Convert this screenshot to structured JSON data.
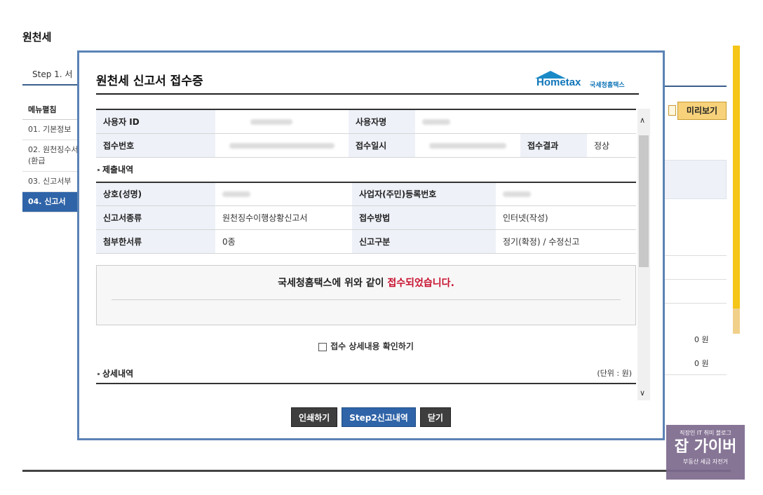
{
  "background": {
    "page_title": "원천세",
    "step_label": "Step 1. 서",
    "menu_head": "메뉴펼침",
    "menu_items": [
      {
        "label": "01. 기본정보"
      },
      {
        "label": "02. 원천징수서(환급"
      },
      {
        "label": "03. 신고서부"
      },
      {
        "label": "04. 신고서"
      }
    ],
    "preview_label": "미리보기",
    "won_values": [
      "0 원",
      "0 원"
    ],
    "accent_color": "#2f64a8",
    "stripe_color": "#f5c518"
  },
  "modal": {
    "title": "원천세 신고서 접수증",
    "logo_text": "Hometax",
    "logo_kr": "국세청홈택스",
    "receipt_table": {
      "row1": {
        "user_id_label": "사용자 ID",
        "user_name_label": "사용자명"
      },
      "row2": {
        "receipt_no_label": "접수번호",
        "receipt_date_label": "접수일시",
        "result_label": "접수결과",
        "result_value": "정상"
      }
    },
    "submission_section": "제출내역",
    "submission_table": {
      "row1": {
        "company_label": "상호(성명)",
        "biz_no_label": "사업자(주민)등록번호"
      },
      "row2": {
        "report_type_label": "신고서종류",
        "report_type_value": "원천징수이행상황신고서",
        "method_label": "접수방법",
        "method_value": "인터넷(작성)"
      },
      "row3": {
        "attach_label": "첨부한서류",
        "attach_value": "0종",
        "category_label": "신고구분",
        "category_value": "정기(확정) / 수정신고"
      }
    },
    "notice_prefix": "국세청홈택스에 위와 같이 ",
    "notice_highlight": "접수되었습니다.",
    "confirm_label": "접수 상세내용 확인하기",
    "detail_section": "상세내역",
    "detail_unit": "(단위 : 원)",
    "buttons": {
      "print": "인쇄하기",
      "step2": "Step2신고내역",
      "close": "닫기"
    }
  },
  "watermark": {
    "top": "직장인 IT 취미 블로그",
    "main": "잡 가이버",
    "bottom": "부동산 세금 자전거"
  }
}
